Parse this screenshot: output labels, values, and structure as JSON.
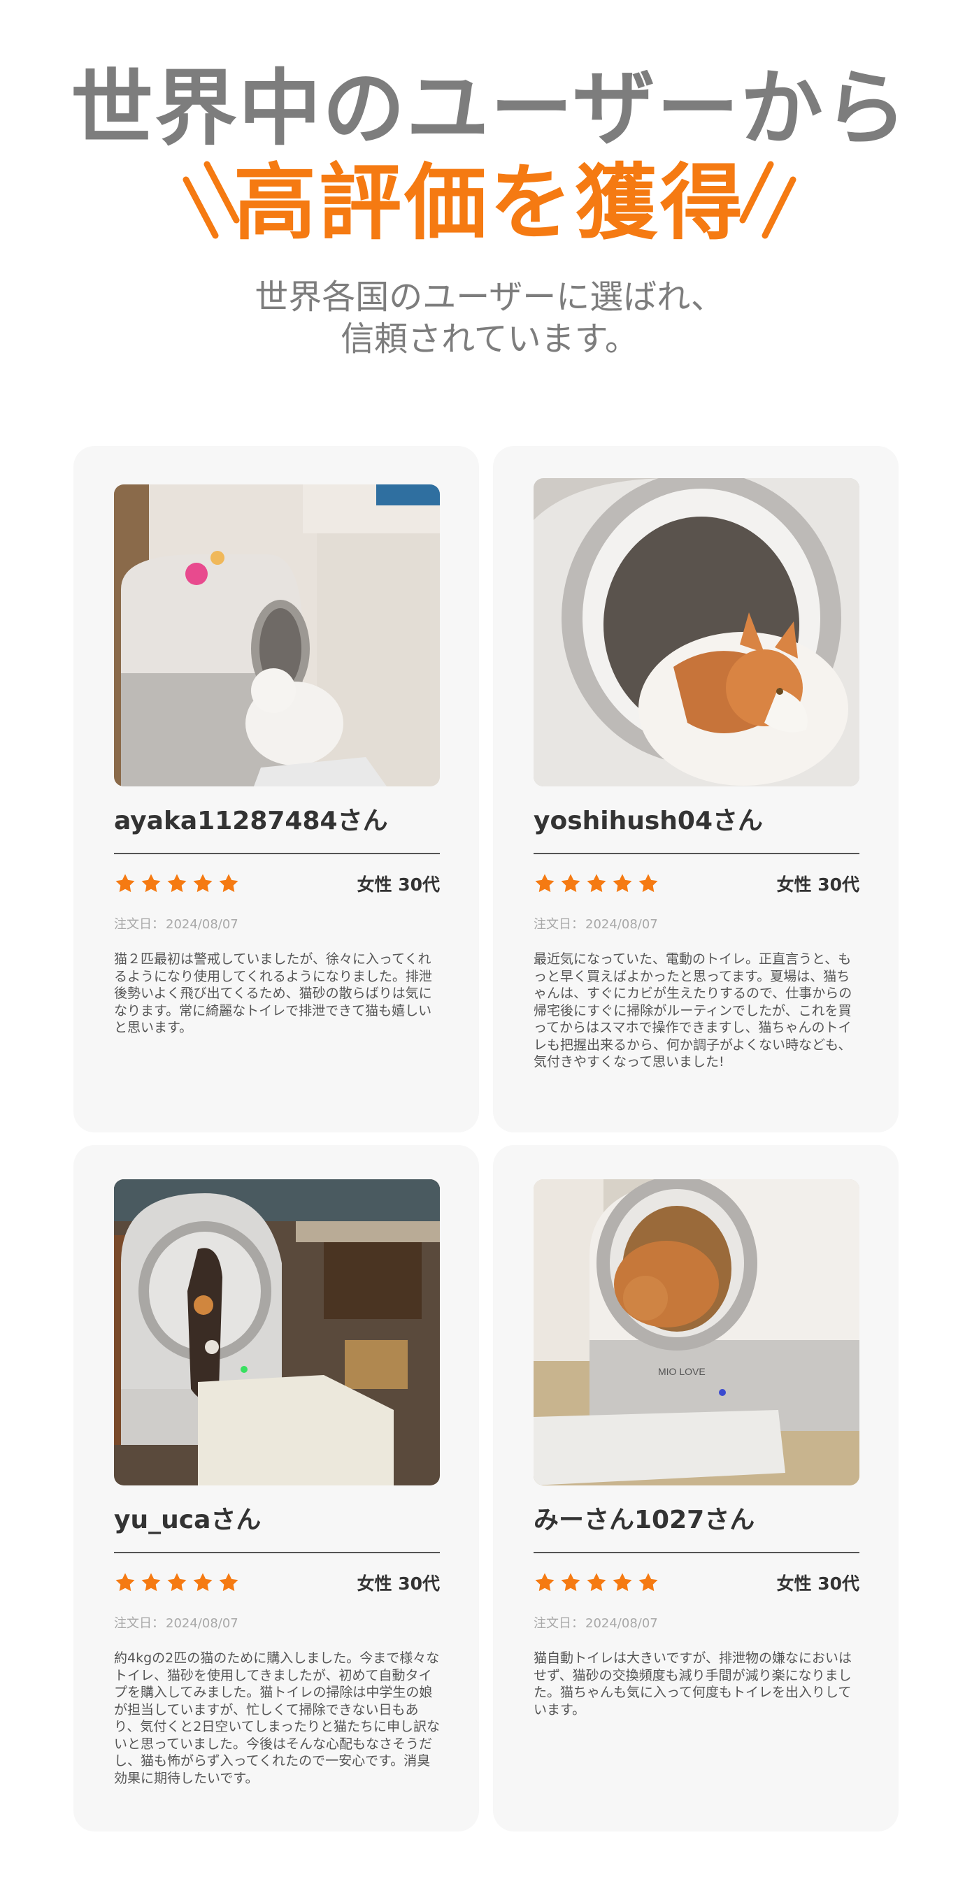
{
  "header": {
    "title": "世界中のユーザーから",
    "accent_title": "高評価を獲得",
    "subtitle_line1": "世界各国のユーザーに選ばれ、",
    "subtitle_line2": "信頼されています。",
    "accent_color": "#f57a12",
    "title_color": "#7d7d7d"
  },
  "reviews": [
    {
      "user": "ayaka11287484さん",
      "rating": 5,
      "demographic": "女性 30代",
      "date_label": "注文日：",
      "date": "2024/08/07",
      "text": "猫２匹最初は警戒していましたが、徐々に入ってくれるようになり使用してくれるようになりました。排泄後勢いよく飛び出てくるため、猫砂の散らばりは気になります。常に綺麗なトイレで排泄できて猫も嬉しいと思います。",
      "photo_icon": "white-cat-entering-litter-box-photo"
    },
    {
      "user": "yoshihush04さん",
      "rating": 5,
      "demographic": "女性 30代",
      "date_label": "注文日：",
      "date": "2024/08/07",
      "text": "最近気になっていた、電動のトイレ。正直言うと、もっと早く買えばよかったと思ってます。夏場は、猫ちゃんは、すぐにカビが生えたりするので、仕事からの帰宅後にすぐに掃除がルーティンでしたが、これを買ってからはスマホで操作できますし、猫ちゃんのトイレも把握出来るから、何か調子がよくない時なども、気付きやすくなって思いました!",
      "photo_icon": "orange-white-cat-in-litter-box-photo"
    },
    {
      "user": "yu_ucaさん",
      "rating": 5,
      "demographic": "女性 30代",
      "date_label": "注文日：",
      "date": "2024/08/07",
      "text": "約4kgの2匹の猫のために購入しました。今まで様々なトイレ、猫砂を使用してきましたが、初めて自動タイプを購入してみました。猫トイレの掃除は中学生の娘が担当していますが、忙しくて掃除できない日もあり、気付くと2日空いてしまったりと猫たちに申し訳ないと思っていました。今後はそんな心配もなさそうだし、猫も怖がらず入ってくれたので一安心です。消臭効果に期待したいです。",
      "photo_icon": "calico-cat-climbing-litter-box-photo"
    },
    {
      "user": "みーさん1027さん",
      "rating": 5,
      "demographic": "女性 30代",
      "date_label": "注文日：",
      "date": "2024/08/07",
      "text": "猫自動トイレは大きいですが、排泄物の嫌なにおいはせず、猫砂の交換頻度も減り手間が減り楽になりました。猫ちゃんも気に入って何度もトイレを出入りしています。",
      "photo_icon": "orange-cat-inside-litter-box-photo",
      "photo_text": "MIO LOVE"
    }
  ],
  "star_color": "#f57a12"
}
